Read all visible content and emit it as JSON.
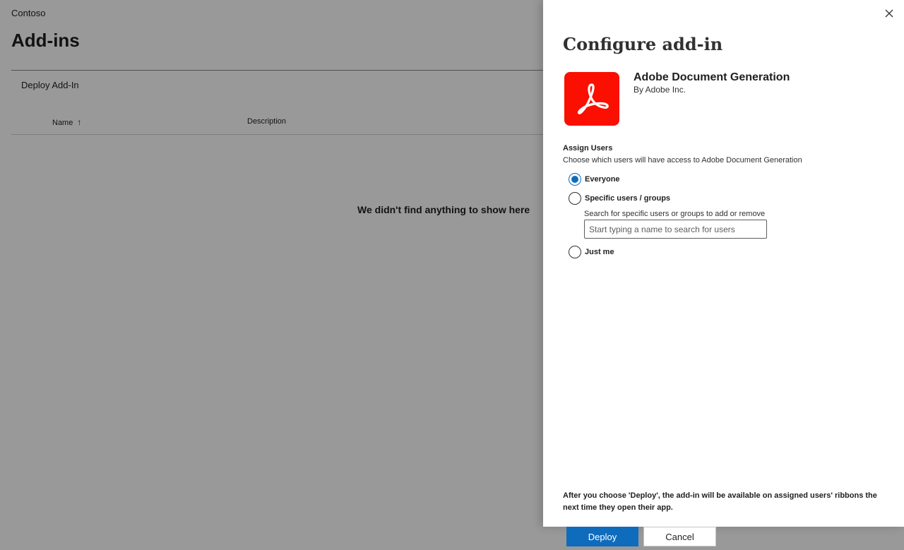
{
  "background": {
    "org_name": "Contoso",
    "page_title": "Add-ins",
    "deploy_link": "Deploy Add-In",
    "columns": {
      "name": "Name",
      "description": "Description"
    },
    "empty_message": "We didn't find anything to show here"
  },
  "panel": {
    "title": "Configure add-in",
    "app": {
      "name": "Adobe Document Generation",
      "publisher": "By Adobe Inc.",
      "logo_color": "#fa0f00"
    },
    "assign": {
      "label": "Assign Users",
      "description": "Choose which users will have access to Adobe Document Generation",
      "options": [
        {
          "label": "Everyone",
          "selected": true
        },
        {
          "label": "Specific users / groups",
          "selected": false
        },
        {
          "label": "Just me",
          "selected": false
        }
      ],
      "search_hint": "Search for specific users or groups to add or remove",
      "search_placeholder": "Start typing a name to search for users",
      "search_value": ""
    },
    "footer_note": "After you choose 'Deploy', the add-in will be available on assigned users' ribbons the next time they open their app.",
    "buttons": {
      "deploy": "Deploy",
      "cancel": "Cancel"
    },
    "accent_color": "#0f6cbd"
  }
}
